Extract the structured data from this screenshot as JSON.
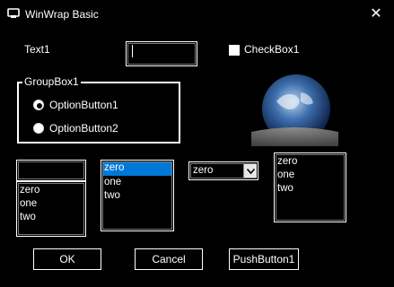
{
  "window": {
    "title": "WinWrap Basic",
    "close_glyph": "✕"
  },
  "text1": {
    "label": "Text1",
    "value": ""
  },
  "checkbox1": {
    "label": "CheckBox1",
    "checked": false
  },
  "groupbox1": {
    "title": "GroupBox1",
    "options": [
      {
        "label": "OptionButton1",
        "selected": true
      },
      {
        "label": "OptionButton2",
        "selected": false
      }
    ]
  },
  "picture": {
    "icon": "earth-image-icon"
  },
  "combo_simple": {
    "value": "",
    "items": [
      "zero",
      "one",
      "two"
    ]
  },
  "listbox": {
    "items": [
      "zero",
      "one",
      "two"
    ],
    "selected_index": 0
  },
  "dropdown": {
    "value": "zero",
    "icon": "chevron-down-icon"
  },
  "listbox2": {
    "items": [
      "zero",
      "one",
      "two"
    ]
  },
  "buttons": {
    "ok": "OK",
    "cancel": "Cancel",
    "push1": "PushButton1"
  },
  "colors": {
    "background": "#000000",
    "selection": "#0078d7",
    "text": "#ffffff"
  }
}
